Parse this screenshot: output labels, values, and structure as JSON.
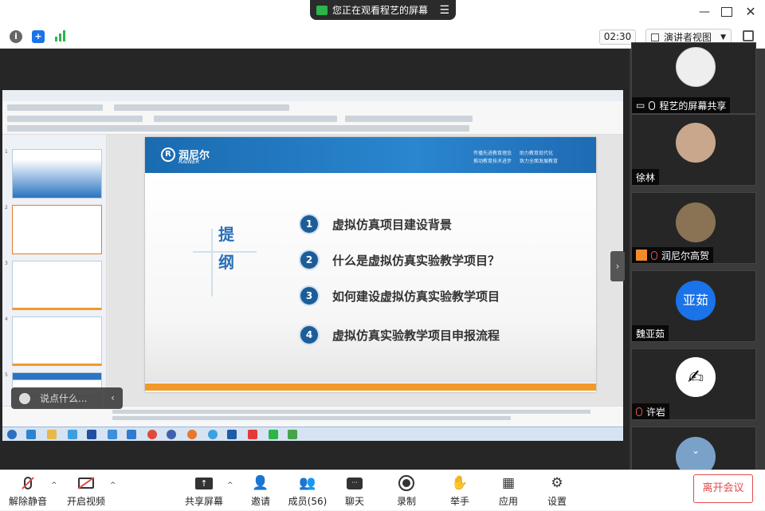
{
  "banner": {
    "text": "您正在观看程艺的屏幕"
  },
  "toolbar": {
    "timer": "02:30",
    "view_mode": "演讲者视图"
  },
  "slide": {
    "brand": "润尼尔",
    "brand_en": "RAINER",
    "slogans": [
      "传播先进教育理念",
      "助力教育现代化",
      "推动教育技术进步",
      "致力全面发展教育"
    ],
    "outline_title": "提纲",
    "items": [
      {
        "num": "1",
        "text": "虚拟仿真项目建设背景"
      },
      {
        "num": "2",
        "text": "什么是虚拟仿真实验教学项目？"
      },
      {
        "num": "3",
        "text": "如何建设虚拟仿真实验教学项目"
      },
      {
        "num": "4",
        "text": "虚拟仿真实验教学项目申报流程"
      }
    ]
  },
  "chat": {
    "placeholder": "说点什么..."
  },
  "participants": [
    {
      "name": "程艺的屏幕共享",
      "mic": "on",
      "screen": true
    },
    {
      "name": "徐林",
      "mic": "none"
    },
    {
      "name": "润尼尔高贺",
      "mic": "off"
    },
    {
      "name": "魏亚茹",
      "mic": "none",
      "initials": "亚茹",
      "color": "#1a73e8"
    },
    {
      "name": "许岩",
      "mic": "off"
    }
  ],
  "bottom": {
    "mute": "解除静音",
    "video": "开启视频",
    "share": "共享屏幕",
    "invite": "邀请",
    "members": "成员(56)",
    "chat": "聊天",
    "record": "录制",
    "raise": "举手",
    "apps": "应用",
    "settings": "设置",
    "leave": "离开会议"
  },
  "colors": {
    "accent": "#1a73e8",
    "danger": "#e24b4b",
    "slide_blue": "#1a6bb0",
    "slide_orange": "#f19a2a"
  }
}
